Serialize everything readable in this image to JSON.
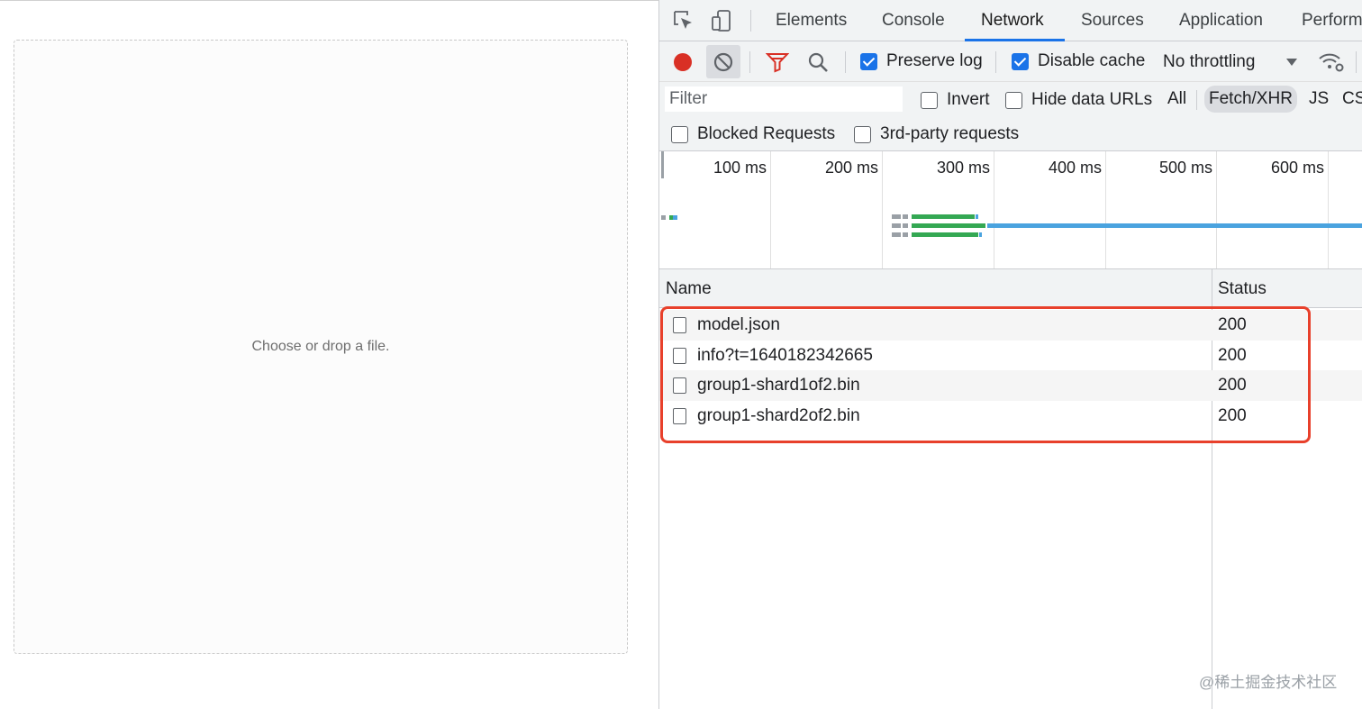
{
  "page": {
    "drop_zone_text": "Choose or drop a file."
  },
  "devtools": {
    "tabs": [
      {
        "label": "Elements"
      },
      {
        "label": "Console"
      },
      {
        "label": "Network",
        "active": true
      },
      {
        "label": "Sources"
      },
      {
        "label": "Application"
      },
      {
        "label": "Perform"
      }
    ],
    "toolbar": {
      "preserve_log": {
        "label": "Preserve log",
        "checked": true
      },
      "disable_cache": {
        "label": "Disable cache",
        "checked": true
      },
      "throttling": "No throttling"
    },
    "filter": {
      "placeholder": "Filter",
      "invert": {
        "label": "Invert",
        "checked": false
      },
      "hide_data_urls": {
        "label": "Hide data URLs",
        "checked": false
      },
      "types": [
        "All",
        "Fetch/XHR",
        "JS",
        "CS"
      ],
      "selected_type": "Fetch/XHR",
      "blocked_requests": {
        "label": "Blocked Requests",
        "checked": false
      },
      "third_party": {
        "label": "3rd-party requests",
        "checked": false
      }
    },
    "overview": {
      "ticks": [
        "100 ms",
        "200 ms",
        "300 ms",
        "400 ms",
        "500 ms",
        "600 ms"
      ]
    },
    "grid": {
      "columns": [
        "Name",
        "Status"
      ],
      "rows": [
        {
          "name": "model.json",
          "status": "200"
        },
        {
          "name": "info?t=1640182342665",
          "status": "200"
        },
        {
          "name": "group1-shard1of2.bin",
          "status": "200"
        },
        {
          "name": "group1-shard2of2.bin",
          "status": "200"
        }
      ]
    },
    "colors": {
      "accent": "#1a73e8",
      "record": "#d93025",
      "filter_icon": "#d93025",
      "highlight": "#e8402b",
      "waterfall_green": "#34a853",
      "waterfall_blue": "#4aa3df"
    }
  },
  "watermark": "@稀土掘金技术社区"
}
